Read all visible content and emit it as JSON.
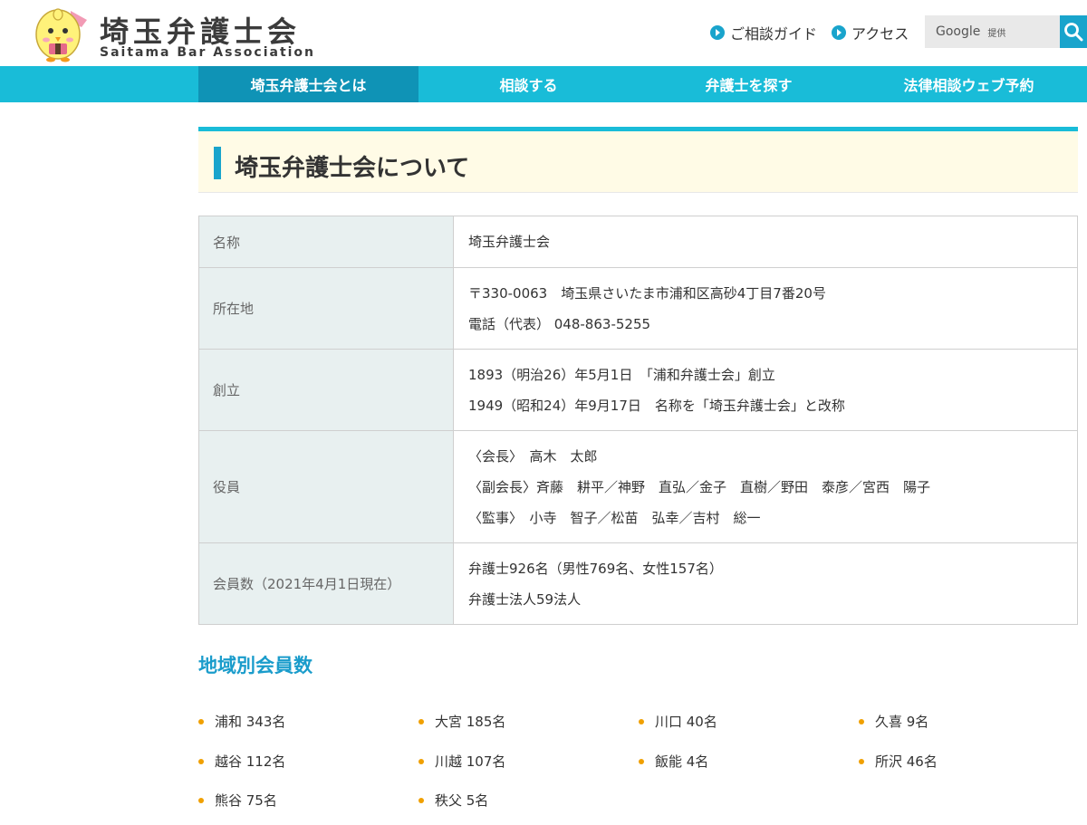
{
  "header": {
    "logo_jp": "埼玉弁護士会",
    "logo_en": "Saitama Bar Association",
    "links": [
      "ご相談ガイド",
      "アクセス"
    ],
    "search": {
      "brand": "Google",
      "suffix": "提供"
    }
  },
  "nav": [
    "埼玉弁護士会とは",
    "相談する",
    "弁護士を探す",
    "法律相談ウェブ予約"
  ],
  "page_title": "埼玉弁護士会について",
  "info": [
    {
      "label": "名称",
      "lines": [
        "埼玉弁護士会"
      ]
    },
    {
      "label": "所在地",
      "lines": [
        "〒330-0063　埼玉県さいたま市浦和区高砂4丁目7番20号",
        "電話（代表） 048-863-5255"
      ]
    },
    {
      "label": "創立",
      "lines": [
        "1893（明治26）年5月1日　「浦和弁護士会」創立",
        "1949（昭和24）年9月17日　名称を「埼玉弁護士会」と改称"
      ]
    },
    {
      "label": "役員",
      "lines": [
        "〈会長〉　高木　太郎",
        "〈副会長〉斉藤　耕平／神野　直弘／金子　直樹／野田　泰彦／宮西　陽子",
        "〈監事〉　小寺　智子／松苗　弘幸／吉村　総一"
      ]
    },
    {
      "label": "会員数（2021年4月1日現在）",
      "lines": [
        "弁護士926名（男性769名、女性157名）",
        "弁護士法人59法人"
      ]
    }
  ],
  "regions_title": "地域別会員数",
  "regions": [
    "浦和 343名",
    "大宮 185名",
    "川口 40名",
    "久喜 9名",
    "越谷 112名",
    "川越 107名",
    "飯能 4名",
    "所沢 46名",
    "熊谷 75名",
    "秩父 5名"
  ],
  "colors": {
    "accent": "#19bcd8",
    "nav_active": "#0f93b6",
    "bullet": "#f0a000",
    "subheading": "#1a9ccb"
  }
}
